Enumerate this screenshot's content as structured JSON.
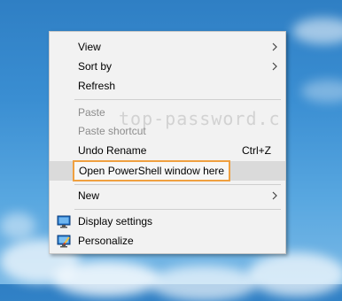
{
  "watermark": "top-password.c",
  "context_menu": {
    "items": [
      {
        "label": "View",
        "submenu": true
      },
      {
        "label": "Sort by",
        "submenu": true
      },
      {
        "label": "Refresh"
      },
      {
        "label": "Paste",
        "disabled": true
      },
      {
        "label": "Paste shortcut",
        "disabled": true
      },
      {
        "label": "Undo Rename",
        "shortcut": "Ctrl+Z"
      },
      {
        "label": "Open PowerShell window here",
        "highlighted": true,
        "highlight_color": "#f0a040"
      },
      {
        "label": "New",
        "submenu": true
      },
      {
        "label": "Display settings",
        "icon": "display-settings-icon"
      },
      {
        "label": "Personalize",
        "icon": "personalize-icon"
      }
    ]
  }
}
